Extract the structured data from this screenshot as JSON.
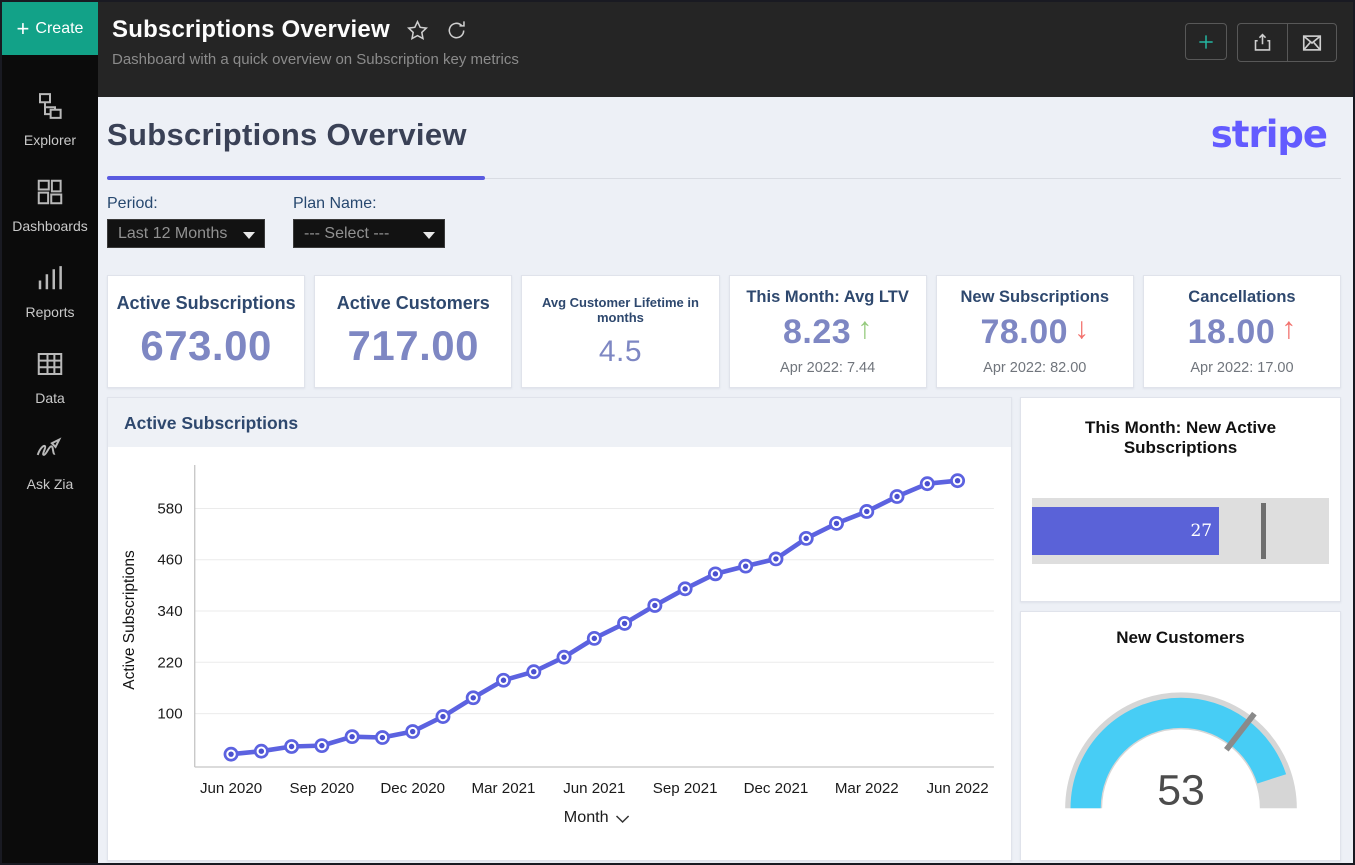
{
  "sidebar": {
    "create_label": "Create",
    "items": [
      {
        "label": "Explorer"
      },
      {
        "label": "Dashboards"
      },
      {
        "label": "Reports"
      },
      {
        "label": "Data"
      },
      {
        "label": "Ask Zia"
      }
    ]
  },
  "topbar": {
    "title": "Subscriptions Overview",
    "subtitle": "Dashboard with a quick overview on Subscription key metrics"
  },
  "page": {
    "title": "Subscriptions Overview",
    "brand": "stripe"
  },
  "filters": [
    {
      "label": "Period:",
      "value": "Last 12 Months"
    },
    {
      "label": "Plan Name:",
      "value": "--- Select ---"
    }
  ],
  "kpis": [
    {
      "title": "Active Subscriptions",
      "value": "673.00"
    },
    {
      "title": "Active Customers",
      "value": "717.00"
    },
    {
      "title": "Avg Customer Lifetime in months",
      "value": "4.5"
    },
    {
      "title": "This Month: Avg LTV",
      "value": "8.23",
      "trend_glyph": "↑",
      "trend_color": "#95ca7d",
      "sub": "Apr 2022: 7.44"
    },
    {
      "title": "New Subscriptions",
      "value": "78.00",
      "trend_glyph": "↓",
      "trend_color": "#f2716d",
      "sub": "Apr 2022: 82.00"
    },
    {
      "title": "Cancellations",
      "value": "18.00",
      "trend_glyph": "↑",
      "trend_color": "#f2716d",
      "sub": "Apr 2022: 17.00"
    }
  ],
  "chart_data": [
    {
      "type": "line",
      "title": "Active Subscriptions",
      "xlabel": "Month",
      "ylabel": "Active Subscriptions",
      "x": [
        "Jun 2020",
        "Jul 2020",
        "Aug 2020",
        "Sep 2020",
        "Oct 2020",
        "Nov 2020",
        "Dec 2020",
        "Jan 2021",
        "Feb 2021",
        "Mar 2021",
        "Apr 2021",
        "May 2021",
        "Jun 2021",
        "Jul 2021",
        "Aug 2021",
        "Sep 2021",
        "Oct 2021",
        "Nov 2021",
        "Dec 2021",
        "Jan 2022",
        "Feb 2022",
        "Mar 2022",
        "Apr 2022",
        "May 2022",
        "Jun 2022"
      ],
      "values": [
        5,
        12,
        23,
        25,
        46,
        44,
        58,
        93,
        137,
        178,
        198,
        232,
        276,
        311,
        353,
        392,
        427,
        445,
        462,
        510,
        545,
        573,
        608,
        638,
        645
      ],
      "x_tick_labels": [
        "Jun 2020",
        "Sep 2020",
        "Dec 2020",
        "Mar 2021",
        "Jun 2021",
        "Sep 2021",
        "Dec 2021",
        "Mar 2022",
        "Jun 2022"
      ],
      "yticks": [
        100,
        220,
        340,
        460,
        580
      ],
      "ylim": [
        -25,
        663
      ],
      "grid": "horizontal",
      "legend": "none",
      "line_color": "#5c62e0",
      "marker_core_color": "#4a50cf"
    },
    {
      "type": "bullet",
      "title": "This Month: New Active Subscriptions",
      "value": 27,
      "bar_pct": 63,
      "target_pct": 77,
      "bar_color": "#5a62d8",
      "track_color": "#dedede",
      "target_color": "#6e6e6e"
    },
    {
      "type": "gauge",
      "title": "New Customers",
      "value": 53,
      "fill_pct": 90,
      "target_pct": 71,
      "fill_color": "#47cdf5",
      "track_color": "#d6d6d6",
      "target_color": "#8a8a8a",
      "value_color": "#4c4c4c"
    }
  ],
  "colors": {
    "accent_teal": "#12a288",
    "brand_purple": "#635bff",
    "underline_purple": "#5a5be0",
    "kpi_value": "#7e87c3",
    "kpi_title": "#2e486e",
    "topbar_bg": "#252525",
    "sidebar_bg": "#0b0b0b"
  }
}
